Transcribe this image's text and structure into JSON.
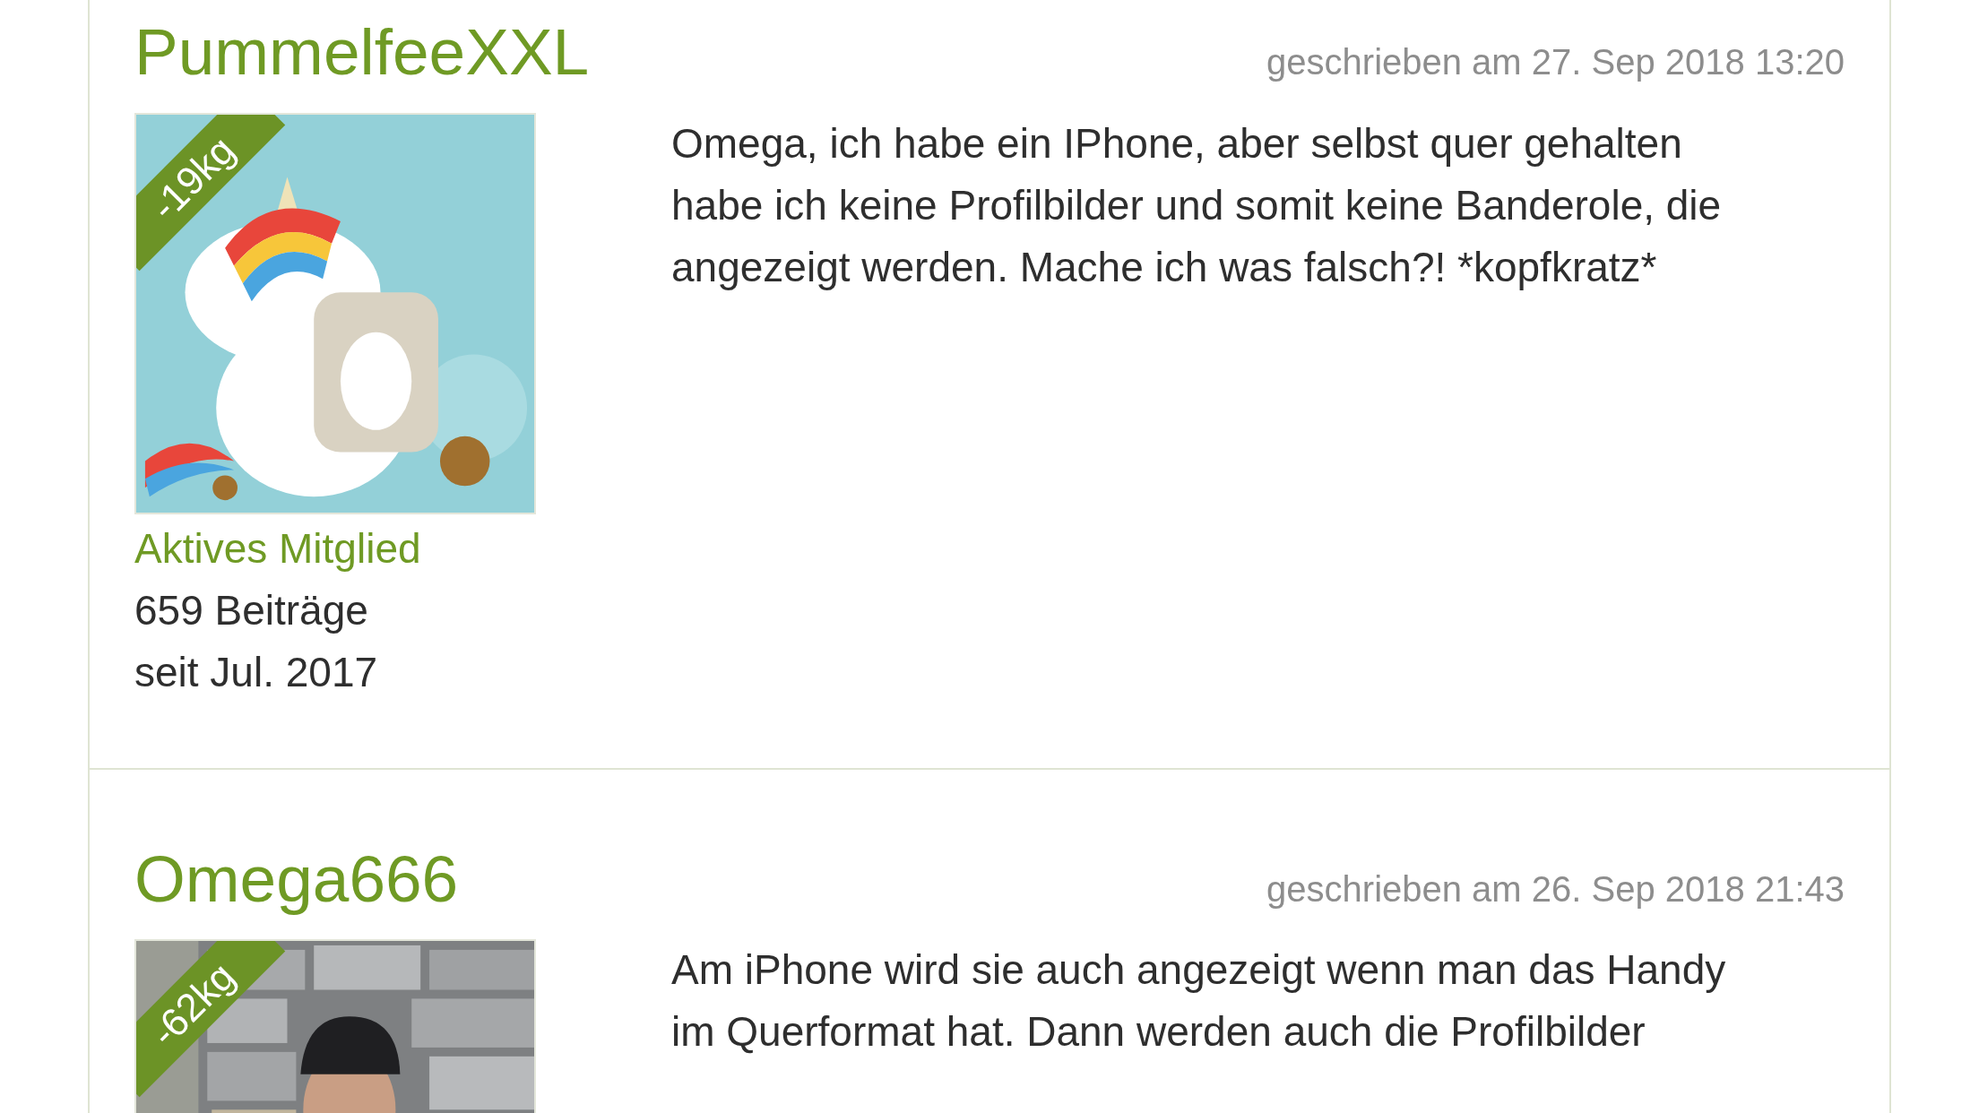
{
  "posts": [
    {
      "author": "PummelfeeXXL",
      "date": "geschrieben am 27. Sep 2018 13:20",
      "badge": "-19kg",
      "rank": "Aktives Mitglied",
      "post_count": "659 Beiträge",
      "member_since": "seit Jul. 2017",
      "text": "Omega, ich habe ein IPhone, aber selbst quer gehalten habe ich keine Profilbilder und somit keine Banderole, die angezeigt werden. Mache ich was falsch?! *kopfkratz*"
    },
    {
      "author": "Omega666",
      "date": "geschrieben am 26. Sep 2018 21:43",
      "badge": "-62kg",
      "text": "Am iPhone wird sie auch angezeigt wenn man das Handy im Querformat hat. Dann werden auch die Profilbilder"
    }
  ]
}
